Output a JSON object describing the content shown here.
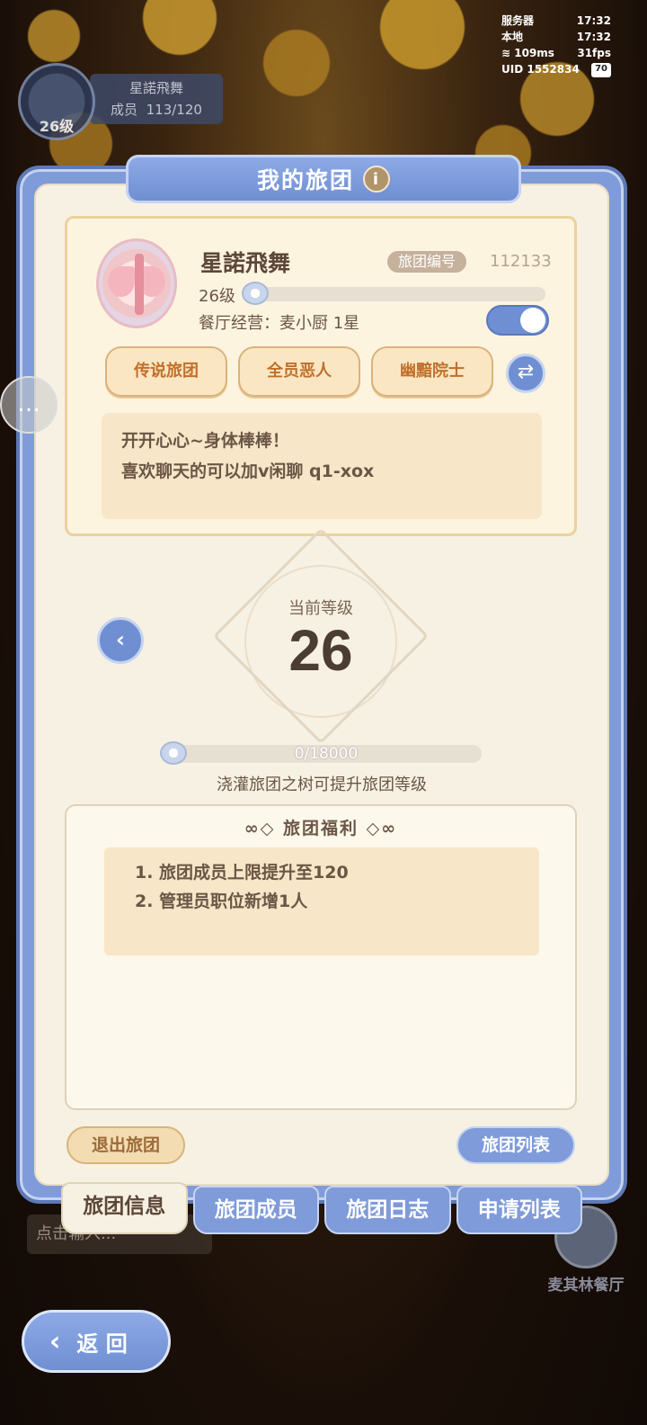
{
  "hud": {
    "server_label": "服务器",
    "server_time": "17:32",
    "local_label": "本地",
    "local_time": "17:32",
    "ping": "109ms",
    "fps": "31fps",
    "uid": "UID 1552834",
    "battery": "70"
  },
  "guild_hud": {
    "name": "星諾飛舞",
    "members_label": "成员",
    "members": "113/120",
    "level": "26级"
  },
  "panel": {
    "title": "我的旅团",
    "guild_name": "星諾飛舞",
    "id_label": "旅团编号",
    "id_value": "112133",
    "level": "26级",
    "cooking": "餐厅经营：麦小厨 1星",
    "tags": [
      "传说旅团",
      "全员恶人",
      "幽黯院士"
    ],
    "desc_line1": "开开心心~身体棒棒！",
    "desc_line2": "喜欢聊天的可以加v闲聊 q1-xox",
    "toggle_on": true
  },
  "level_section": {
    "label": "当前等级",
    "value": "26",
    "exp": "0/18000",
    "exp_progress": 0,
    "hint": "浇灌旅团之树可提升旅团等级"
  },
  "benefits": {
    "title": "旅团福利",
    "items": [
      "1. 旅团成员上限提升至120",
      "2. 管理员职位新增1人"
    ]
  },
  "buttons": {
    "quit": "退出旅团",
    "list": "旅团列表",
    "back": "返 回"
  },
  "tabs": [
    "旅团信息",
    "旅团成员",
    "旅团日志",
    "申请列表"
  ],
  "background": {
    "input_placeholder": "点击输入...",
    "restaurant": "麦其林餐厅"
  },
  "colors": {
    "accent_blue": "#7f9bd9",
    "panel_bg": "#f7f1e3",
    "tag_text": "#c0702a"
  }
}
